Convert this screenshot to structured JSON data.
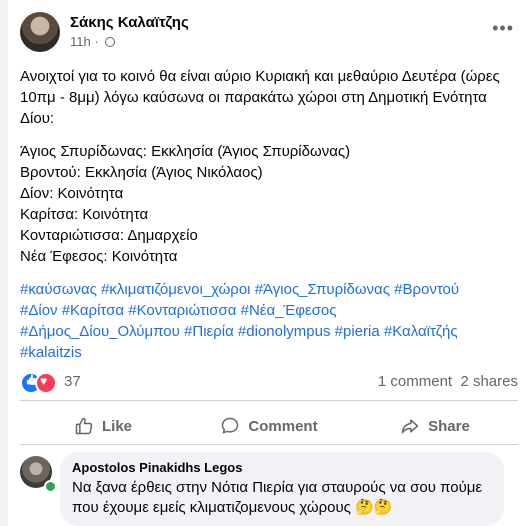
{
  "post": {
    "author": "Σάκης Καλαϊτζης",
    "time": "11h",
    "separator": "·",
    "more": "•••",
    "intro": "Ανοιχτοί για το κοινό θα είναι αύριο Κυριακή και μεθαύριο Δευτέρα (ώρες 10πμ - 8μμ) λόγω καύσωνα οι παρακάτω χώροι στη Δημοτική Ενότητα Δίου:",
    "locations": [
      "Άγιος Σπυρίδωνας: Εκκλησία (Άγιος Σπυρίδωνας)",
      "Βροντού: Εκκλησία (Άγιος Νικόλαος)",
      "Δίον: Κοινότητα",
      "Καρίτσα: Κοινότητα",
      "Κονταριώτισσα: Δημαρχείο",
      "Νέα Έφεσος: Κοινότητα"
    ],
    "hashtags": [
      "#καύσωνας",
      "#κλιματιζόμενοι_χώροι",
      "#Άγιος_Σπυρίδωνας",
      "#Βροντού",
      "#Δίον",
      "#Καρίτσα",
      "#Κονταριώτισσα",
      "#Νέα_Έφεσος",
      "#Δήμος_Δίου_Ολύμπου",
      "#Πιερία",
      "#dionolympus",
      "#pieria",
      "#Καλαϊτζής",
      "#kalaitzis"
    ]
  },
  "reactions": {
    "count": "37",
    "comments": "1 comment",
    "shares": "2 shares"
  },
  "actions": {
    "like": "Like",
    "comment": "Comment",
    "share": "Share"
  },
  "comment": {
    "author": "Apostolos Pinakidhs Legos",
    "text": "Να ξανα έρθεις στην Νότια Πιερία για σταυρούς να σου πούμε που έχουμε εμείς κλιματιζομενους χώρους 🤔🤔"
  },
  "colors": {
    "link": "#216fdb",
    "like": "#1877f2",
    "love": "#f33e58",
    "online": "#31a24c"
  }
}
